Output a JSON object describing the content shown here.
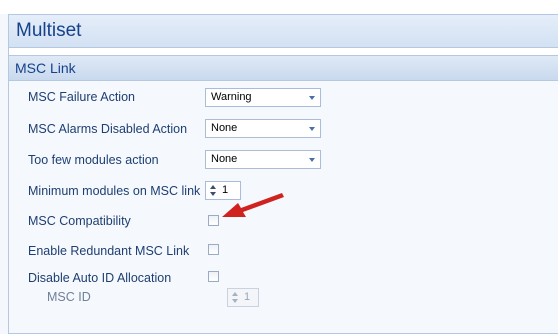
{
  "window": {
    "title": "Multiset"
  },
  "section": {
    "title": "MSC Link"
  },
  "fields": {
    "failure_action": {
      "label": "MSC Failure Action",
      "value": "Warning"
    },
    "alarms_disabled_action": {
      "label": "MSC Alarms Disabled Action",
      "value": "None"
    },
    "too_few_modules_action": {
      "label": "Too few modules action",
      "value": "None"
    },
    "minimum_modules": {
      "label": "Minimum modules on MSC link",
      "value": "1"
    },
    "msc_compatibility": {
      "label": "MSC Compatibility",
      "checked": false
    },
    "enable_redundant": {
      "label": "Enable Redundant MSC Link",
      "checked": false
    },
    "disable_auto_id": {
      "label": "Disable Auto ID Allocation",
      "checked": false
    },
    "msc_id": {
      "label": "MSC ID",
      "value": "1",
      "enabled": false
    }
  },
  "annotation": {
    "arrow_color": "#d0231f",
    "points_to": "msc-compatibility-checkbox"
  },
  "colors": {
    "label": "#1e3f73",
    "title": "#15428b",
    "border": "#b5c8e2"
  }
}
